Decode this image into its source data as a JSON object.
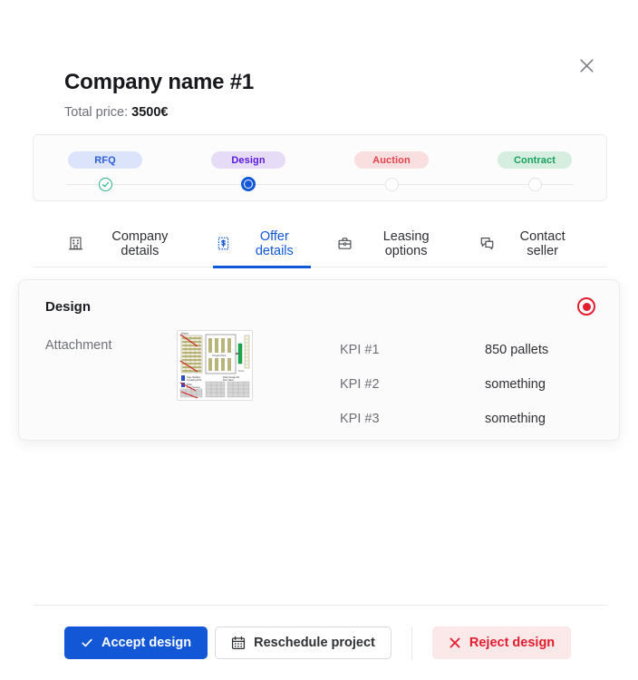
{
  "colors": {
    "brand_blue": "#1257d6",
    "danger_red": "#e11d2e",
    "success_green": "#22b07d",
    "purple": "#5a1ae0",
    "text_dark": "#17181c",
    "text_muted": "#6e7076",
    "card_bg": "#fbfbfc",
    "border": "#e9eaed"
  },
  "close": {
    "icon": "close-icon",
    "label": "Close"
  },
  "header": {
    "title": "Company name #1",
    "price_label": "Total price:",
    "price_value": "3500€"
  },
  "stepper": {
    "steps": [
      {
        "label": "RFQ",
        "state": "done",
        "dot_icon": "check-circle-icon"
      },
      {
        "label": "Design",
        "state": "current",
        "dot_icon": "radio-filled-icon"
      },
      {
        "label": "Auction",
        "state": "upcoming",
        "dot_icon": "circle-empty-icon"
      },
      {
        "label": "Contract",
        "state": "upcoming",
        "dot_icon": "circle-empty-icon"
      }
    ]
  },
  "tabs": [
    {
      "label": "Company details",
      "icon": "building-icon",
      "active": false
    },
    {
      "label": "Offer details",
      "icon": "receipt-dollar-icon",
      "active": true
    },
    {
      "label": "Leasing options",
      "icon": "briefcase-icon",
      "active": false
    },
    {
      "label": "Contact seller",
      "icon": "chat-bubbles-icon",
      "active": false
    }
  ],
  "design_card": {
    "title": "Design",
    "selected": true,
    "radio_icon": "radio-selected-icon",
    "attachment_label": "Attachment",
    "attachment_thumb_name": "warehouse-layout-thumbnail",
    "kpis": [
      {
        "key": "KPI #1",
        "value": "850 pallets"
      },
      {
        "key": "KPI #2",
        "value": "something"
      },
      {
        "key": "KPI #3",
        "value": "something"
      }
    ]
  },
  "footer": {
    "accept": {
      "label": "Accept design",
      "icon": "check-icon"
    },
    "reschedule": {
      "label": "Reschedule project",
      "icon": "calendar-icon"
    },
    "reject": {
      "label": "Reject design",
      "icon": "x-icon"
    }
  }
}
